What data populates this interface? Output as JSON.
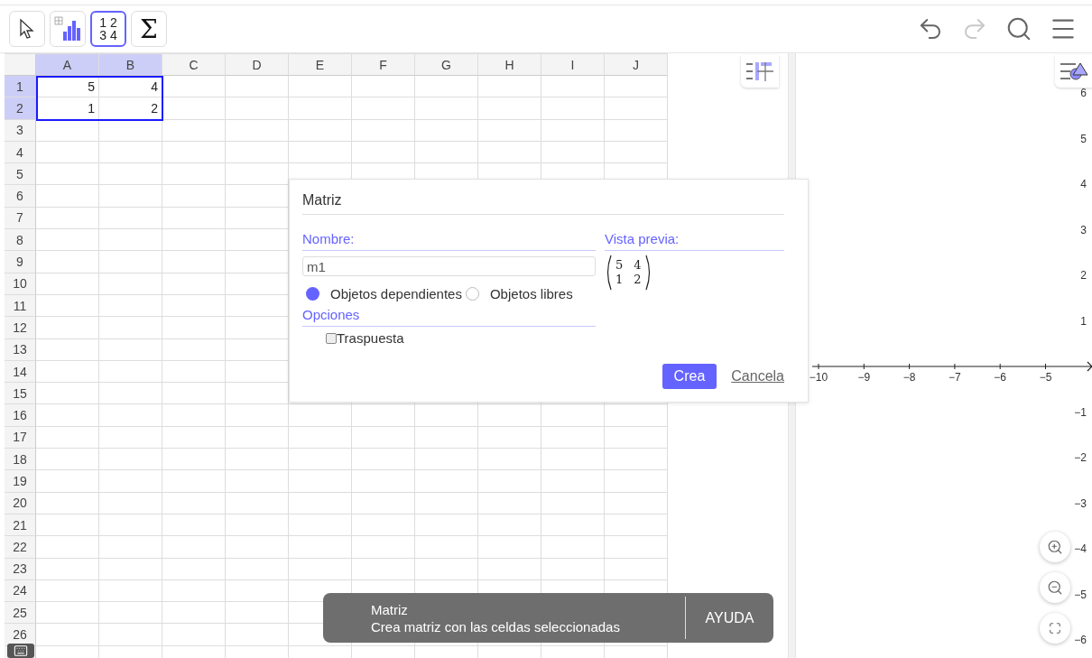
{
  "toolbar": {
    "tools": [
      {
        "kind": "pointer",
        "selected": false
      },
      {
        "kind": "stats",
        "selected": false
      },
      {
        "kind": "matrix",
        "selected": true,
        "digits": [
          "1",
          "2",
          "3",
          "4"
        ]
      },
      {
        "kind": "sum",
        "selected": false,
        "symbol": "Σ"
      }
    ],
    "actions": [
      {
        "kind": "undo",
        "disabled": false
      },
      {
        "kind": "redo",
        "disabled": true
      },
      {
        "kind": "search",
        "disabled": false
      },
      {
        "kind": "menu",
        "disabled": false
      }
    ]
  },
  "spreadsheet": {
    "columns": [
      {
        "label": "A",
        "selected": true
      },
      {
        "label": "B",
        "selected": true
      },
      {
        "label": "C",
        "selected": false
      },
      {
        "label": "D",
        "selected": false
      },
      {
        "label": "E",
        "selected": false
      },
      {
        "label": "F",
        "selected": false
      },
      {
        "label": "G",
        "selected": false
      },
      {
        "label": "H",
        "selected": false
      },
      {
        "label": "I",
        "selected": false
      },
      {
        "label": "J",
        "selected": false
      }
    ],
    "rows": [
      {
        "label": "1",
        "selected": true,
        "cells": [
          "5",
          "4"
        ]
      },
      {
        "label": "2",
        "selected": true,
        "cells": [
          "1",
          "2"
        ]
      },
      {
        "label": "3",
        "selected": false
      },
      {
        "label": "4",
        "selected": false
      },
      {
        "label": "5",
        "selected": false
      },
      {
        "label": "6",
        "selected": false
      },
      {
        "label": "7",
        "selected": false
      },
      {
        "label": "8",
        "selected": false
      },
      {
        "label": "9",
        "selected": false
      },
      {
        "label": "10",
        "selected": false
      },
      {
        "label": "11",
        "selected": false
      },
      {
        "label": "12",
        "selected": false
      },
      {
        "label": "13",
        "selected": false
      },
      {
        "label": "14",
        "selected": false
      },
      {
        "label": "15",
        "selected": false
      },
      {
        "label": "16",
        "selected": false
      },
      {
        "label": "17",
        "selected": false
      },
      {
        "label": "18",
        "selected": false
      },
      {
        "label": "19",
        "selected": false
      },
      {
        "label": "20",
        "selected": false
      },
      {
        "label": "21",
        "selected": false
      },
      {
        "label": "22",
        "selected": false
      },
      {
        "label": "23",
        "selected": false
      },
      {
        "label": "24",
        "selected": false
      },
      {
        "label": "25",
        "selected": false
      },
      {
        "label": "26",
        "selected": false
      },
      {
        "selected": false
      }
    ]
  },
  "dialog": {
    "title": "Matriz",
    "name_label": "Nombre:",
    "name_value": "m1",
    "preview_label": "Vista previa:",
    "preview_matrix": [
      [
        "5",
        "4"
      ],
      [
        "1",
        "2"
      ]
    ],
    "radios": [
      {
        "label": "Objetos dependientes",
        "selected": true
      },
      {
        "label": "Objetos libres",
        "selected": false
      }
    ],
    "options_label": "Opciones",
    "checkbox": {
      "label": "Traspuesta",
      "checked": false
    },
    "create": "Crea",
    "cancel": "Cancela"
  },
  "toast": {
    "title": "Matriz",
    "text": "Crea matriz con las celdas seleccionadas",
    "action": "AYUDA"
  },
  "graph": {
    "x_labels": [
      "−10",
      "−9",
      "−8",
      "−7",
      "−6",
      "−5"
    ],
    "y_labels": [
      "6",
      "5",
      "4",
      "3",
      "2",
      "1",
      "−1",
      "−2",
      "−3",
      "−4",
      "−5",
      "−6"
    ]
  }
}
